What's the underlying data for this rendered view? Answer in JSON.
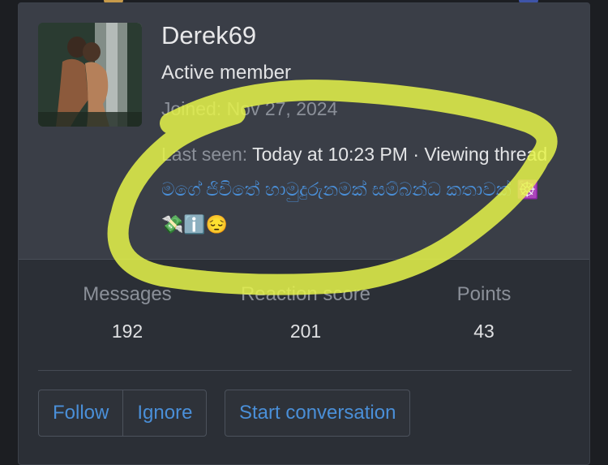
{
  "profile": {
    "username": "Derek69",
    "title": "Active member",
    "joined_label": "Joined:",
    "joined_value": "Nov 27, 2024",
    "last_seen_label": "Last seen:",
    "last_seen_value": "Today at 10:23 PM",
    "separator": "·",
    "activity": "Viewing thread",
    "thread_title": "මගේ ජිවිතේ හාමුදුරුනමක් සම්බන්ධ කතාවක්",
    "thread_emojis": "☸️💸ℹ️😔"
  },
  "stats": [
    {
      "label": "Messages",
      "value": "192"
    },
    {
      "label": "Reaction score",
      "value": "201"
    },
    {
      "label": "Points",
      "value": "43"
    }
  ],
  "actions": {
    "follow": "Follow",
    "ignore": "Ignore",
    "start_conversation": "Start conversation"
  },
  "colors": {
    "link": "#4a8fd8",
    "highlight_marker": "#e6f54a"
  }
}
